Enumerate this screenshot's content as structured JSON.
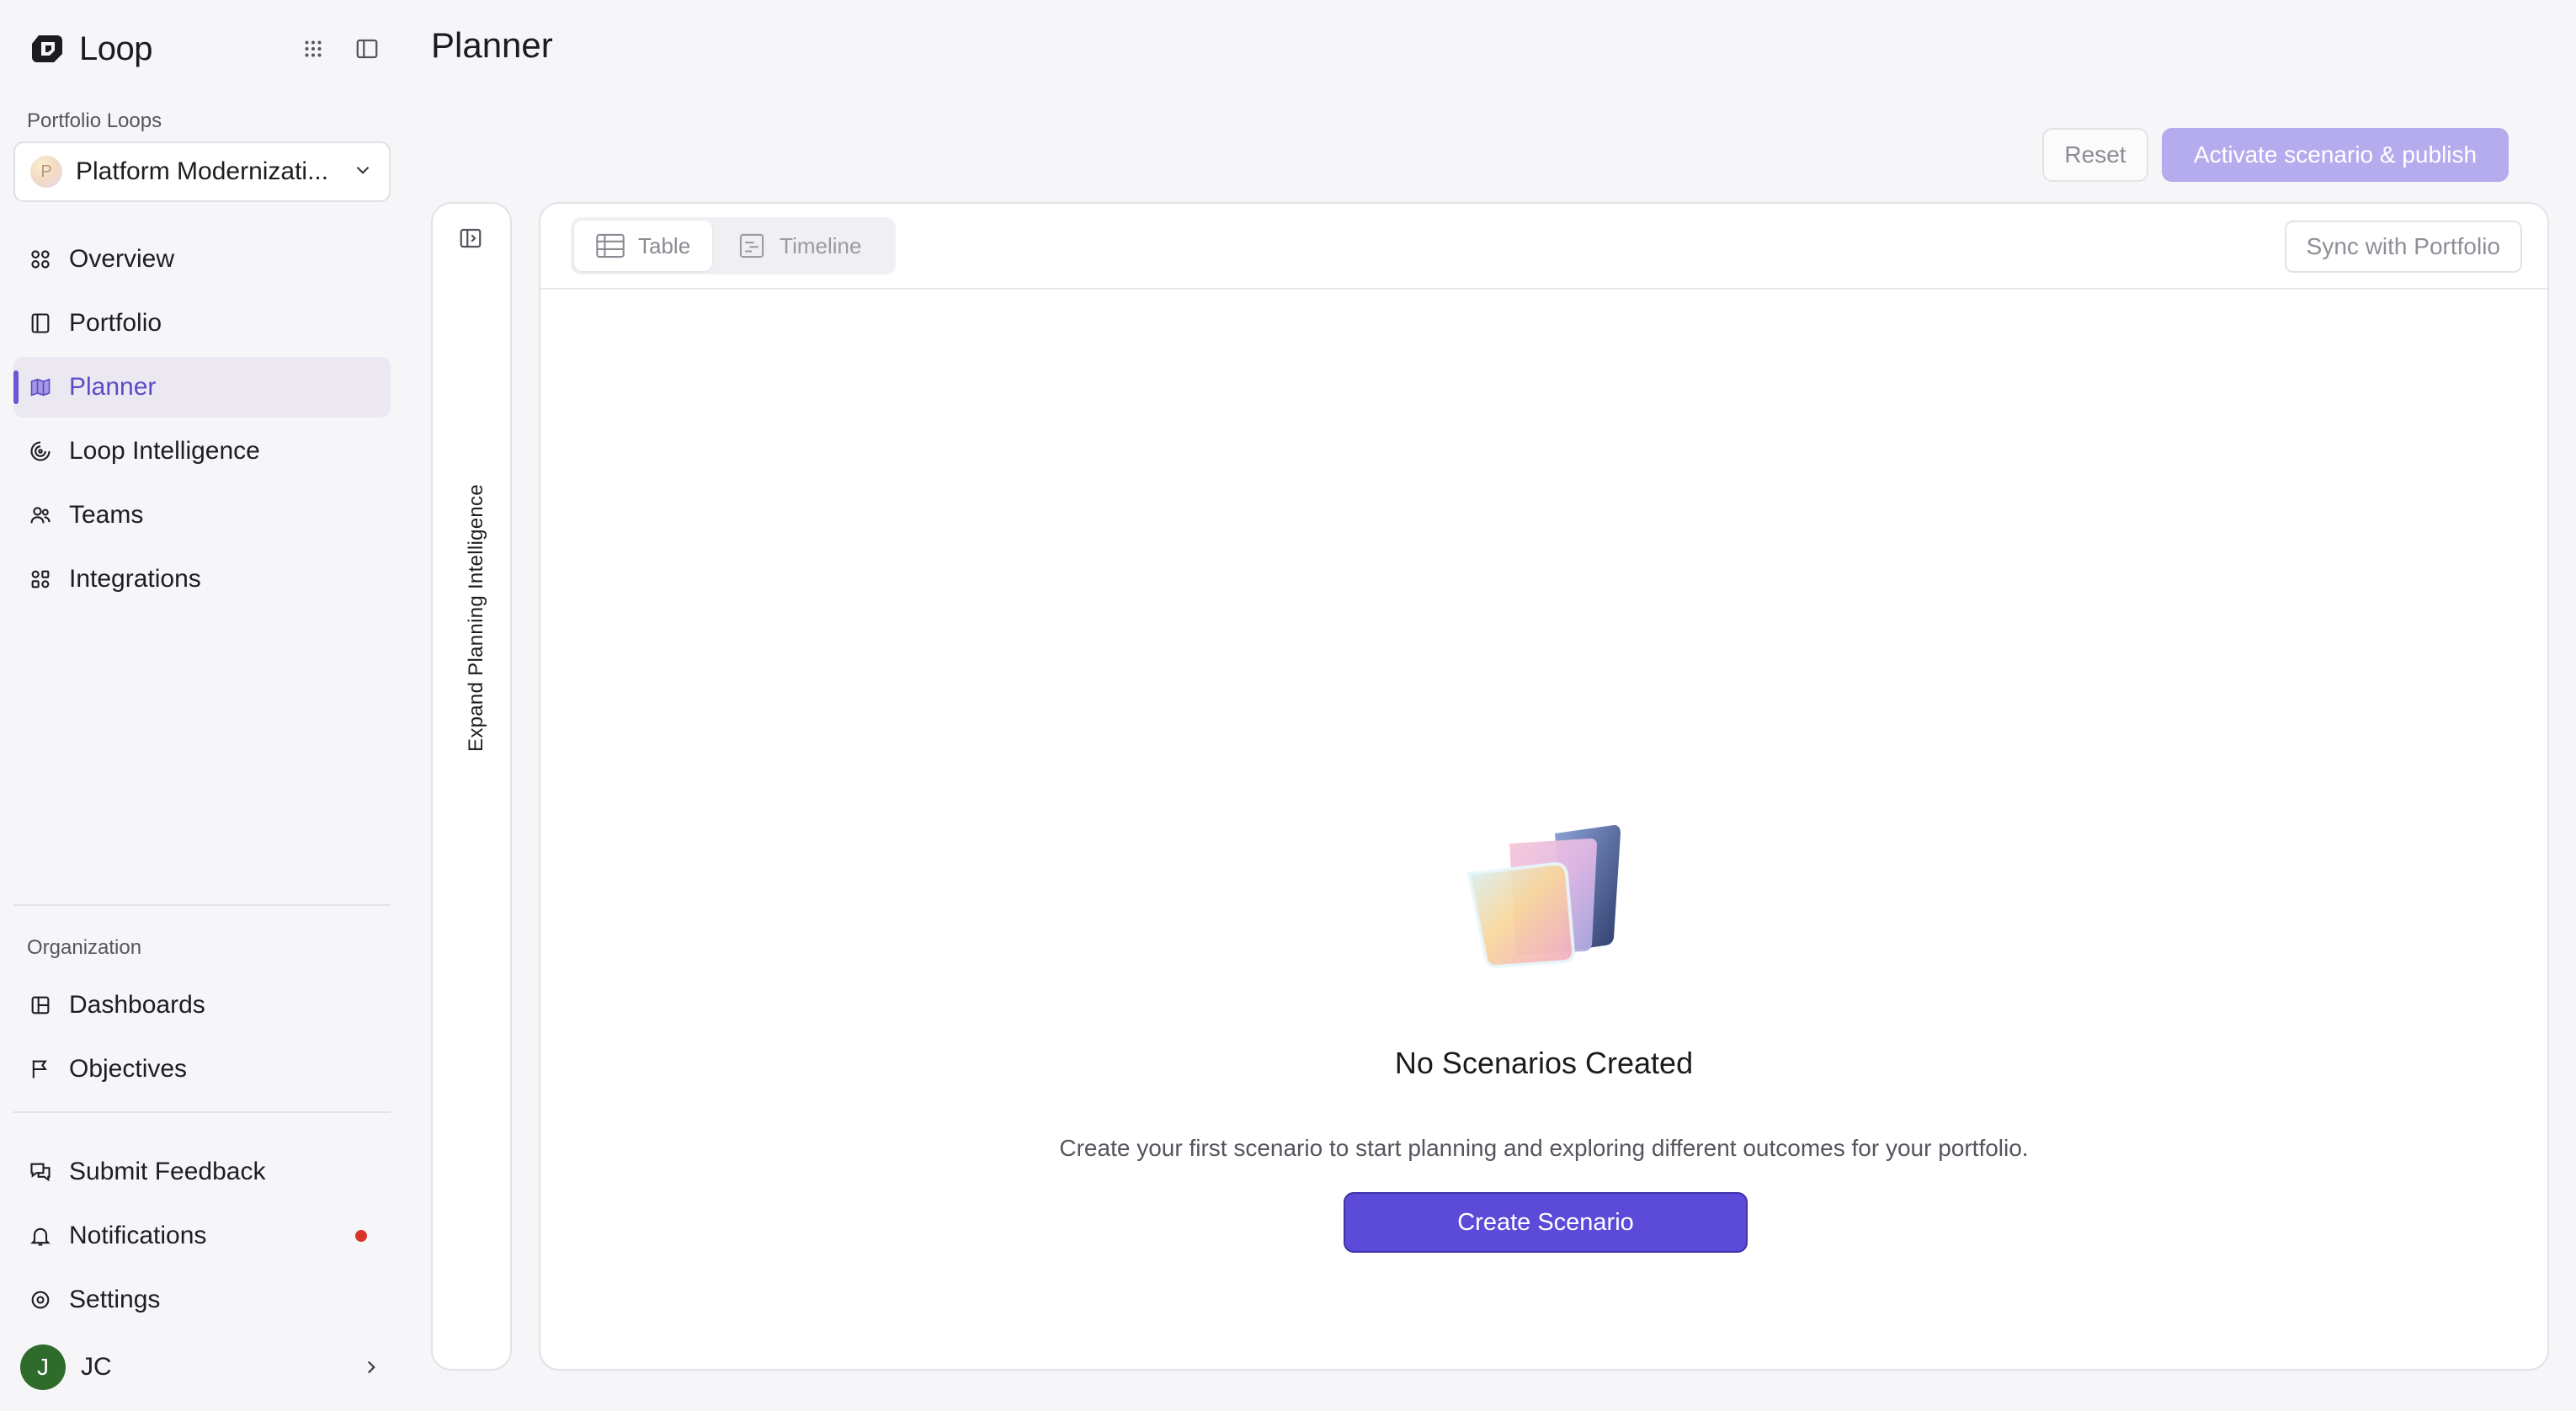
{
  "app": {
    "name": "Loop"
  },
  "sidebar": {
    "portfolio_label": "Portfolio Loops",
    "selected_loop": {
      "initial": "P",
      "name": "Platform Modernizati..."
    },
    "nav": [
      {
        "label": "Overview",
        "icon": "overview-icon"
      },
      {
        "label": "Portfolio",
        "icon": "portfolio-icon"
      },
      {
        "label": "Planner",
        "icon": "map-icon",
        "active": true
      },
      {
        "label": "Loop Intelligence",
        "icon": "intelligence-icon"
      },
      {
        "label": "Teams",
        "icon": "users-icon"
      },
      {
        "label": "Integrations",
        "icon": "integrations-icon"
      }
    ],
    "org_label": "Organization",
    "org_nav": [
      {
        "label": "Dashboards",
        "icon": "dashboard-icon"
      },
      {
        "label": "Objectives",
        "icon": "flag-icon"
      }
    ],
    "footer_nav": [
      {
        "label": "Submit Feedback",
        "icon": "chat-icon"
      },
      {
        "label": "Notifications",
        "icon": "bell-icon",
        "has_dot": true
      },
      {
        "label": "Settings",
        "icon": "gear-icon"
      }
    ],
    "user": {
      "initial": "J",
      "name": "JC"
    }
  },
  "page": {
    "title": "Planner",
    "reset_label": "Reset",
    "activate_label": "Activate scenario & publish",
    "side_panel_label": "Expand Planning Intelligence",
    "tabs": [
      {
        "label": "Table",
        "active": true
      },
      {
        "label": "Timeline",
        "active": false
      }
    ],
    "sync_label": "Sync with Portfolio",
    "empty": {
      "title": "No Scenarios Created",
      "description": "Create your first scenario to start planning and exploring different outcomes for your portfolio.",
      "button_label": "Create Scenario"
    }
  },
  "colors": {
    "accent": "#5c4bd8",
    "accent_disabled": "#b5aced",
    "active_nav_bg": "#ebe8f2",
    "notification": "#d8352a",
    "user_avatar": "#2f6b2a"
  }
}
